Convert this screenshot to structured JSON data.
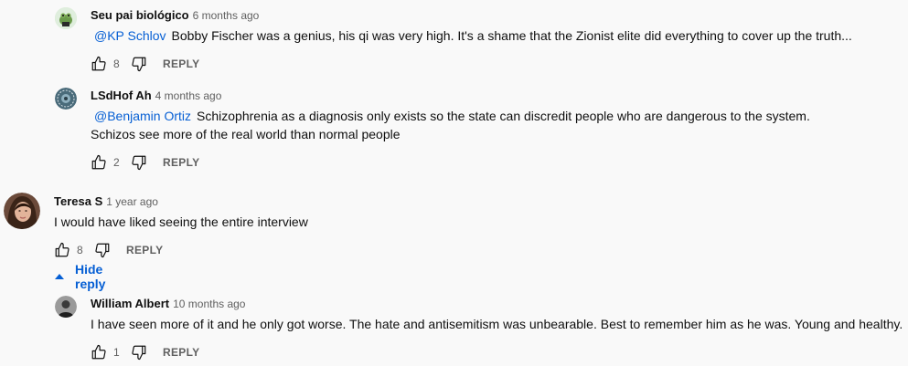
{
  "comments": [
    {
      "author": "Seu pai biológico",
      "time": "6 months ago",
      "mention": "@KP Schlov",
      "text": "Bobby Fischer was a genius, his qi was very high. It's a shame that the Zionist elite did everything to cover up the truth...",
      "likes": "8",
      "reply_label": "REPLY",
      "avatar_icon": "frog-avatar-icon"
    },
    {
      "author": "LSdHof Ah",
      "time": "4 months ago",
      "mention": "@Benjamin Ortiz",
      "text": "Schizophrenia as a diagnosis only exists so the state can discredit people who are dangerous to the system.",
      "text2": "Schizos see more of the real world than normal people",
      "likes": "2",
      "reply_label": "REPLY",
      "avatar_icon": "circle-logo-avatar-icon"
    },
    {
      "author": "Teresa S",
      "time": "1 year ago",
      "text": "I would have liked seeing the entire interview",
      "likes": "8",
      "reply_label": "REPLY",
      "hide_reply_label": "Hide reply",
      "avatar_icon": "woman-avatar-icon"
    },
    {
      "author": "William Albert",
      "time": "10 months ago",
      "text": "I have seen more of it and he only got worse. The hate and antisemitism was unbearable. Best to remember him as he was. Young and healthy.",
      "likes": "1",
      "reply_label": "REPLY",
      "avatar_icon": "man-avatar-icon"
    }
  ],
  "colors": {
    "link": "#065fd4",
    "secondary_text": "#606060",
    "background": "#f9f9f9"
  }
}
